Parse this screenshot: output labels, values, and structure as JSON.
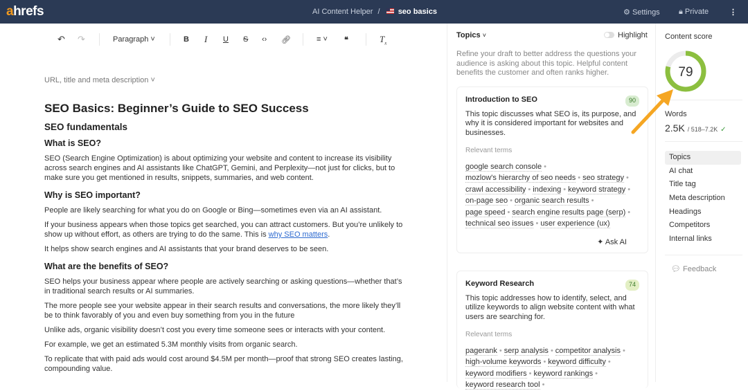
{
  "header": {
    "logo": "ahrefs",
    "app": "AI Content Helper",
    "separator": "/",
    "document": "seo basics",
    "settings": "Settings",
    "privacy": "Private"
  },
  "toolbar": {
    "block_type": "Paragraph"
  },
  "editor": {
    "meta_toggle": "URL, title and meta description",
    "title": "SEO Basics: Beginner’s Guide to SEO Success",
    "h2": "SEO fundamentals",
    "h3_1": "What is SEO?",
    "p1": "SEO (Search Engine Optimization) is about optimizing your website and content to increase its visibility across search engines and AI assistants like ChatGPT, Gemini, and Perplexity—not just for clicks, but to make sure you get mentioned in results, snippets, summaries, and web content.",
    "h3_2": "Why is SEO important?",
    "p2": "People are likely searching for what you do on Google or Bing—sometimes even via an AI assistant.",
    "p3": "If your business appears when those topics get searched, you can attract customers. But you’re unlikely to show up without effort, as others are trying to do the same. This is ",
    "p3_link": "why SEO matters",
    "p3_end": ".",
    "p4": "It helps show search engines and AI assistants that your brand deserves to be seen.",
    "h3_3": "What are the benefits of SEO?",
    "p5": "SEO helps your business appear where people are actively searching or asking questions—whether that’s in traditional search results or AI summaries.",
    "p6": "The more people see your website appear in their search results and conversations, the more likely they’ll be to think favorably of you and even buy something from you in the future",
    "p7": "Unlike ads, organic visibility doesn’t cost you every time someone sees or interacts with your content.",
    "p8": "For example, we get an estimated 5.3M monthly visits from organic search.",
    "p9": "To replicate that with paid ads would cost around $4.5M per month—proof that strong SEO creates lasting, compounding value."
  },
  "topics": {
    "title": "Topics",
    "highlight": "Highlight",
    "intro": "Refine your draft to better address the questions your audience is asking about this topic. Helpful content benefits the customer and often ranks higher.",
    "relevant_label": "Relevant terms",
    "ask_ai": "Ask AI",
    "cards": [
      {
        "title": "Introduction to SEO",
        "score": "90",
        "desc": "This topic discusses what SEO is, its purpose, and why it is considered important for websites and businesses.",
        "terms": [
          "google search console",
          "mozlow's hierarchy of seo needs",
          "seo strategy",
          "crawl accessibility",
          "indexing",
          "keyword strategy",
          "on-page seo",
          "organic search results",
          "page speed",
          "search engine results page (serp)",
          "technical seo issues",
          "user experience (ux)"
        ]
      },
      {
        "title": "Keyword Research",
        "score": "74",
        "desc": "This topic addresses how to identify, select, and utilize keywords to align website content with what users are searching for.",
        "terms": [
          "pagerank",
          "serp analysis",
          "competitor analysis",
          "high-volume keywords",
          "keyword difficulty",
          "keyword modifiers",
          "keyword rankings",
          "keyword research tool"
        ]
      }
    ]
  },
  "side": {
    "content_score_label": "Content score",
    "score": 79,
    "score_max": 100,
    "words_label": "Words",
    "words": "2.5K",
    "words_range": "/ 518–7.2K",
    "nav": [
      "Topics",
      "AI chat",
      "Title tag",
      "Meta description",
      "Headings",
      "Competitors",
      "Internal links"
    ],
    "feedback": "Feedback"
  },
  "colors": {
    "header": "#2b3a55",
    "score": "#8cbf3f",
    "arrow": "#f5a623"
  }
}
